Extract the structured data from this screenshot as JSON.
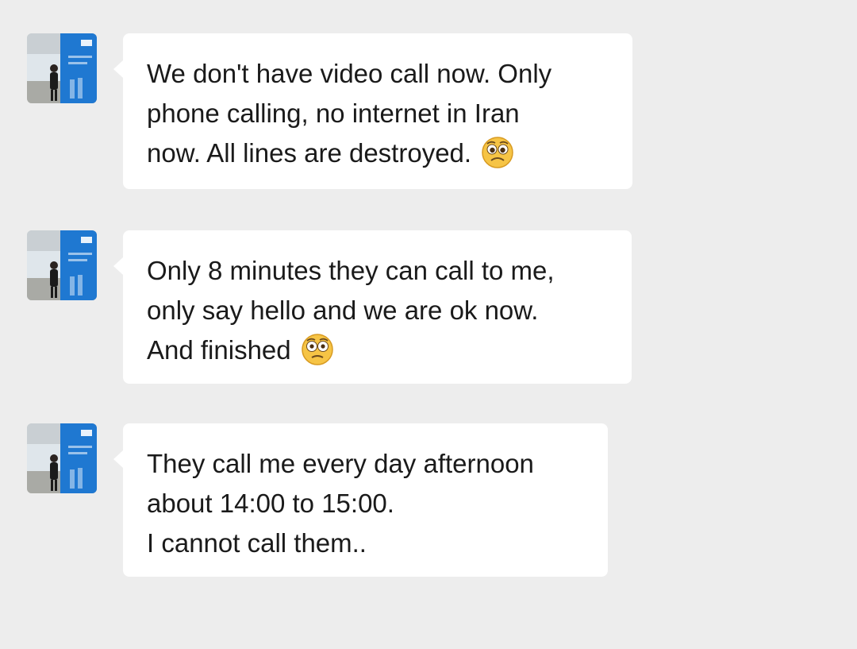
{
  "conversation": {
    "messages": [
      {
        "avatar_icon": "user-photo-avatar",
        "lines": [
          "We don't have video call now. Only",
          "phone calling, no internet in Iran",
          "now. All lines are destroyed."
        ],
        "emoji": "pleading-face-emoji"
      },
      {
        "avatar_icon": "user-photo-avatar",
        "lines": [
          "Only 8 minutes they can call to me,",
          "only say hello and we are ok now.",
          "And finished"
        ],
        "emoji": "flushed-face-emoji"
      },
      {
        "avatar_icon": "user-photo-avatar",
        "lines": [
          "They call me every day afternoon",
          "about 14:00 to 15:00.",
          "I cannot call them.."
        ]
      }
    ]
  },
  "colors": {
    "background": "#ededed",
    "bubble": "#ffffff",
    "text": "#1a1a1a",
    "avatar_blue": "#1f78d1",
    "emoji_yellow": "#f6c445"
  }
}
